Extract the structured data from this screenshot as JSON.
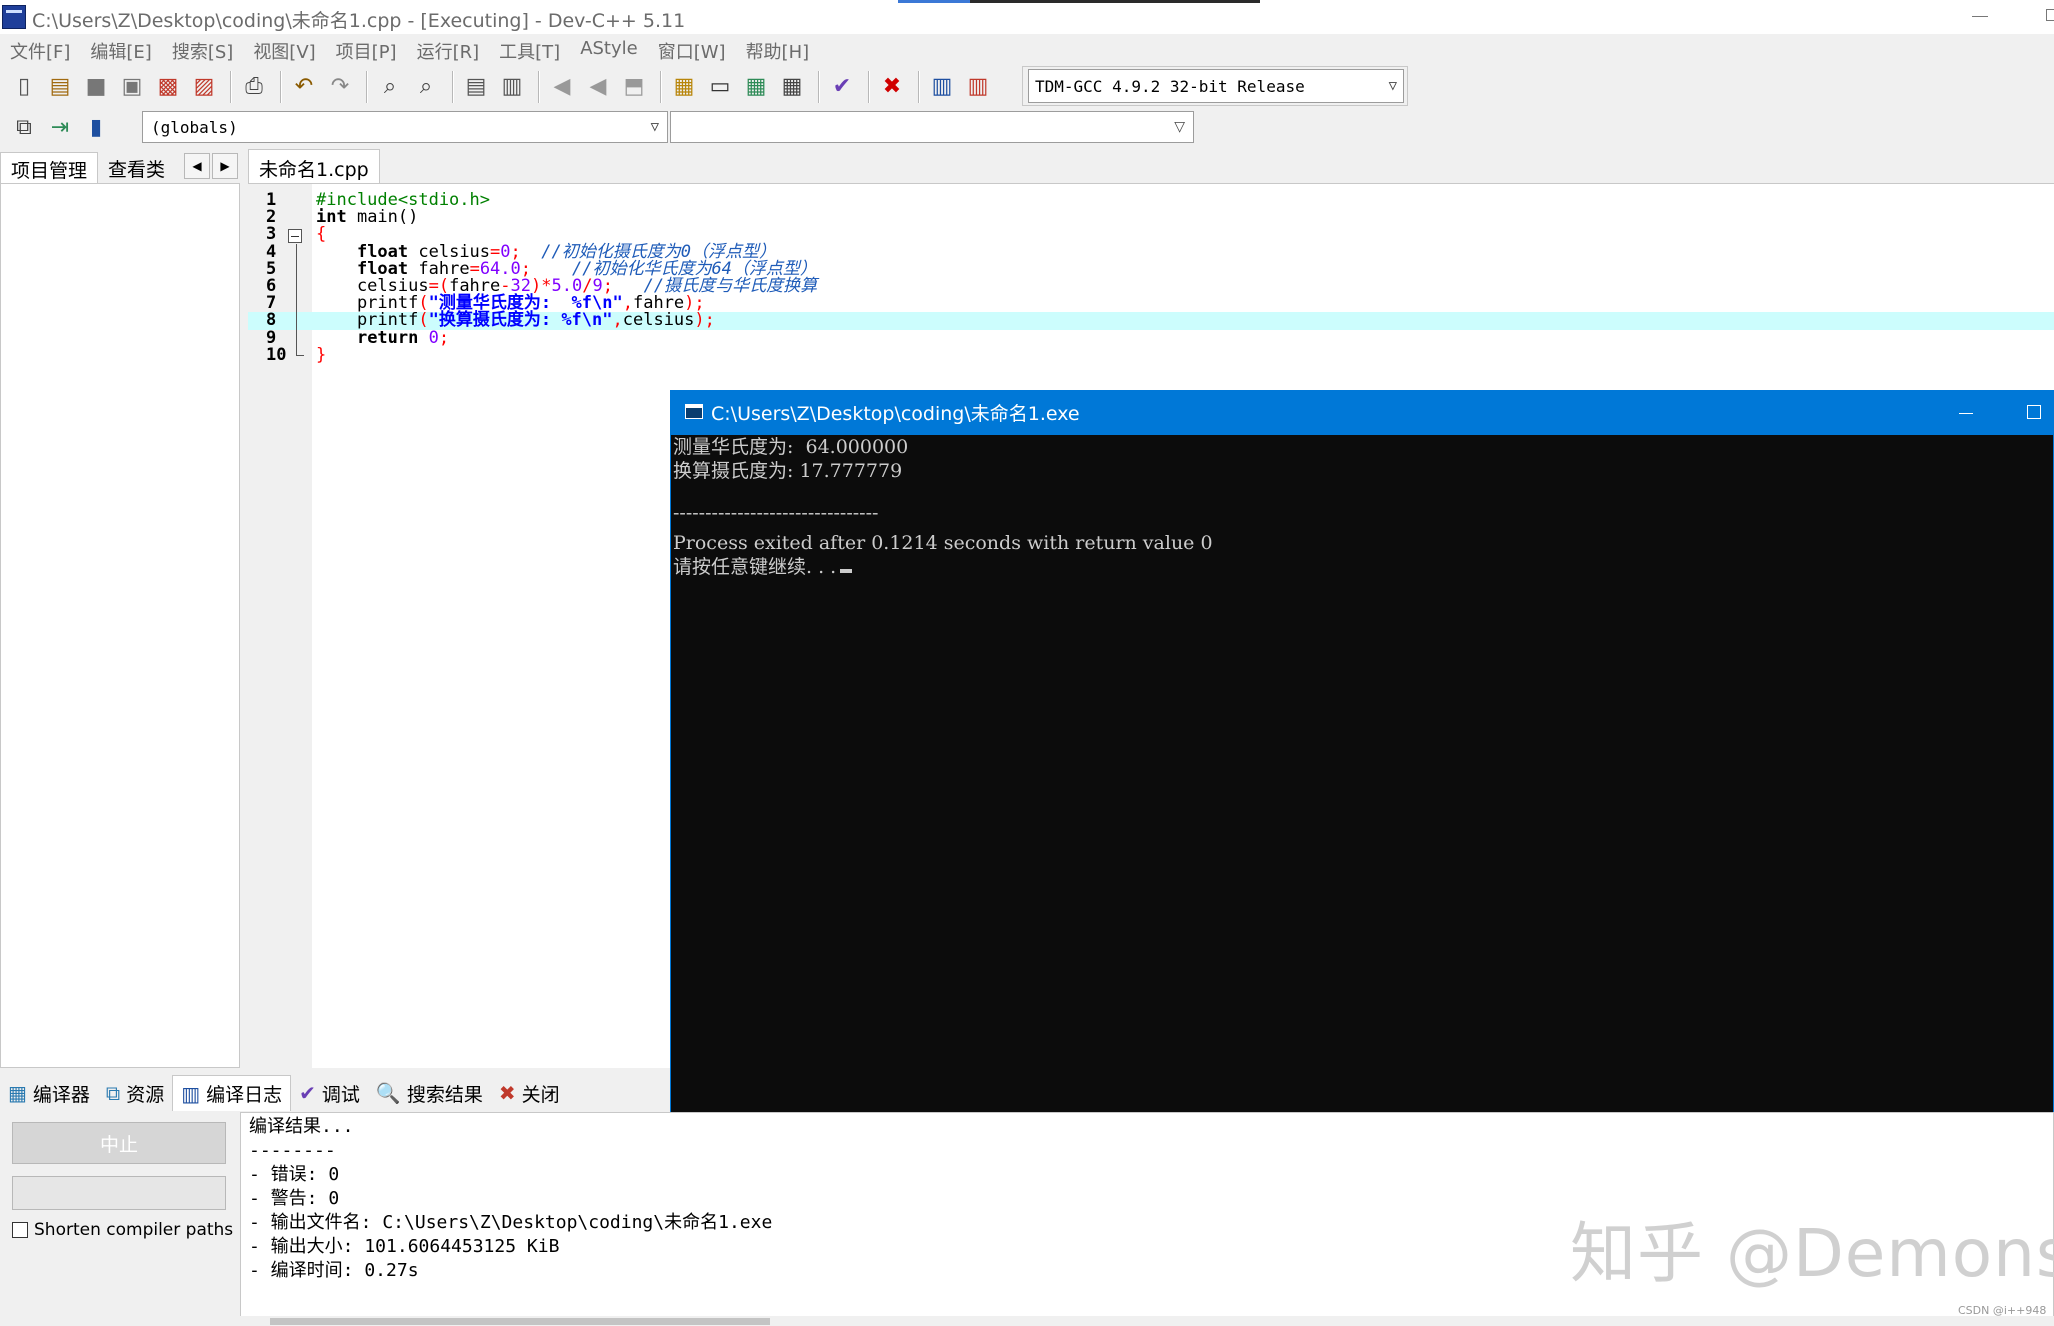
{
  "window": {
    "title": "C:\\Users\\Z\\Desktop\\coding\\未命名1.cpp - [Executing] - Dev-C++ 5.11"
  },
  "menu": [
    "文件[F]",
    "编辑[E]",
    "搜索[S]",
    "视图[V]",
    "项目[P]",
    "运行[R]",
    "工具[T]",
    "AStyle",
    "窗口[W]",
    "帮助[H]"
  ],
  "toolbar": {
    "compiler": "TDM-GCC 4.9.2 32-bit Release",
    "scope": "(globals)",
    "members": ""
  },
  "left_tabs": [
    "项目管理",
    "查看类"
  ],
  "editor": {
    "tab": "未命名1.cpp",
    "lines": [
      {
        "n": "1",
        "tokens": [
          [
            "c-pre",
            "#include<stdio.h>"
          ]
        ]
      },
      {
        "n": "2",
        "tokens": [
          [
            "c-kw",
            "int"
          ],
          [
            "c-id",
            " main()"
          ]
        ]
      },
      {
        "n": "3",
        "tokens": [
          [
            "c-sym",
            "{"
          ]
        ]
      },
      {
        "n": "4",
        "tokens": [
          [
            "c-id",
            "    "
          ],
          [
            "c-kw",
            "float"
          ],
          [
            "c-id",
            " celsius"
          ],
          [
            "c-sym",
            "="
          ],
          [
            "c-num",
            "0"
          ],
          [
            "c-sym",
            ";"
          ],
          [
            "c-id",
            "  "
          ],
          [
            "c-cmt",
            "//初始化摄氏度为0（浮点型）"
          ]
        ]
      },
      {
        "n": "5",
        "tokens": [
          [
            "c-id",
            "    "
          ],
          [
            "c-kw",
            "float"
          ],
          [
            "c-id",
            " fahre"
          ],
          [
            "c-sym",
            "="
          ],
          [
            "c-num",
            "64.0"
          ],
          [
            "c-sym",
            ";"
          ],
          [
            "c-id",
            "    "
          ],
          [
            "c-cmt",
            "//初始化华氏度为64（浮点型）"
          ]
        ]
      },
      {
        "n": "6",
        "tokens": [
          [
            "c-id",
            "    celsius"
          ],
          [
            "c-sym",
            "=("
          ],
          [
            "c-id",
            "fahre"
          ],
          [
            "c-sym",
            "-"
          ],
          [
            "c-num",
            "32"
          ],
          [
            "c-sym",
            ")*"
          ],
          [
            "c-num",
            "5.0"
          ],
          [
            "c-sym",
            "/"
          ],
          [
            "c-num",
            "9"
          ],
          [
            "c-sym",
            ";"
          ],
          [
            "c-id",
            "   "
          ],
          [
            "c-cmt",
            "//摄氏度与华氏度换算"
          ]
        ]
      },
      {
        "n": "7",
        "tokens": [
          [
            "c-id",
            "    printf"
          ],
          [
            "c-sym",
            "("
          ],
          [
            "c-str",
            "\"测量华氏度为:  %f\\n\""
          ],
          [
            "c-sym",
            ","
          ],
          [
            "c-id",
            "fahre"
          ],
          [
            "c-sym",
            ");"
          ]
        ]
      },
      {
        "n": "8",
        "tokens": [
          [
            "c-id",
            "    printf"
          ],
          [
            "c-sym",
            "("
          ],
          [
            "c-str",
            "\"换算摄氏度为: %f\\n\""
          ],
          [
            "c-sym",
            ","
          ],
          [
            "c-id",
            "celsius"
          ],
          [
            "c-sym",
            ");"
          ]
        ]
      },
      {
        "n": "9",
        "tokens": [
          [
            "c-id",
            "    "
          ],
          [
            "c-kw",
            "return"
          ],
          [
            "c-id",
            " "
          ],
          [
            "c-num",
            "0"
          ],
          [
            "c-sym",
            ";"
          ]
        ]
      },
      {
        "n": "10",
        "tokens": [
          [
            "c-sym",
            "}"
          ]
        ]
      }
    ],
    "current_line": "8"
  },
  "console": {
    "title": "C:\\Users\\Z\\Desktop\\coding\\未命名1.exe",
    "lines": [
      "测量华氏度为:  64.000000",
      "换算摄氏度为: 17.777779",
      "",
      "--------------------------------",
      "Process exited after 0.1214 seconds with return value 0",
      "请按任意键继续. . ."
    ]
  },
  "bottom_tabs": [
    {
      "icon": "grid-icon",
      "glyph": "▦",
      "label": "编译器"
    },
    {
      "icon": "resources-icon",
      "glyph": "⧉",
      "label": "资源"
    },
    {
      "icon": "bar-chart-icon",
      "glyph": "▥",
      "label": "编译日志"
    },
    {
      "icon": "check-icon",
      "glyph": "✔",
      "label": "调试"
    },
    {
      "icon": "search-results-icon",
      "glyph": "🔍",
      "label": "搜索结果"
    },
    {
      "icon": "close-icon",
      "glyph": "✖",
      "label": "关闭"
    }
  ],
  "compile_panel": {
    "stop_label": "中止",
    "shorten_label": "Shorten compiler paths",
    "log": [
      "编译结果...",
      "--------",
      "- 错误: 0",
      "- 警告: 0",
      "- 输出文件名: C:\\Users\\Z\\Desktop\\coding\\未命名1.exe",
      "- 输出大小: 101.6064453125 KiB",
      "- 编译时间: 0.27s"
    ]
  },
  "watermark": "知乎 @Demons",
  "credit": "CSDN @i++948",
  "colors": {
    "console_title": "#0078d7",
    "console_bg": "#0c0c0c",
    "current_line": "#ccfdfd"
  }
}
